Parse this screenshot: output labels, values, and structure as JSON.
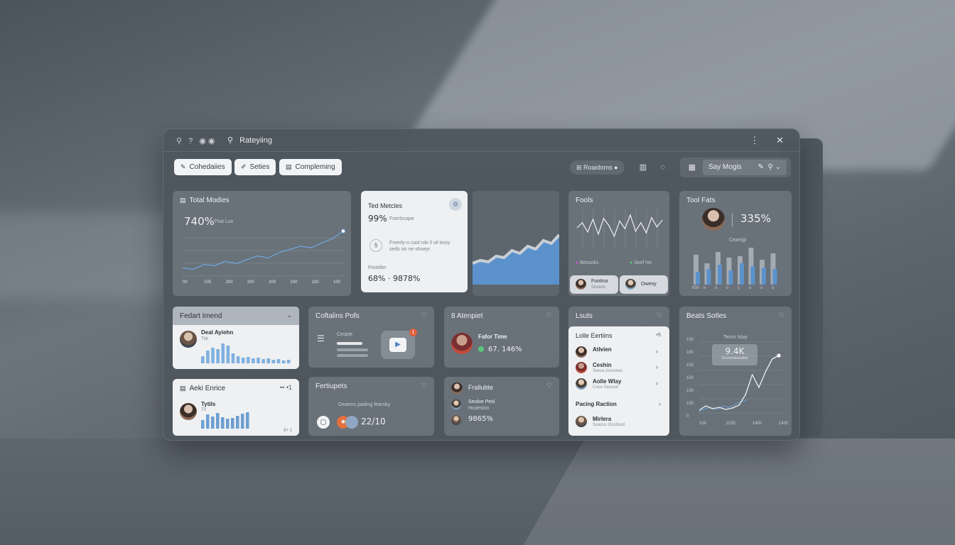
{
  "titlebar": {
    "icons": "⚲ ? ◉◉",
    "search_text": "Rateyiing",
    "menu_icon": "⋮",
    "close_icon": "✕"
  },
  "chips": [
    {
      "label": "Cohedaiies",
      "icon": "pencil-icon"
    },
    {
      "label": "Seties",
      "icon": "pin-icon"
    },
    {
      "label": "Compleming",
      "icon": "document-icon"
    }
  ],
  "toolbar": {
    "pill_label": "Roaidoms",
    "say_label": "Say Mogis"
  },
  "cards": {
    "total_metrics": {
      "title": "Total Modies",
      "value": "740%",
      "value_label": "That Lus",
      "x_labels": [
        "00",
        "205",
        "200",
        "200",
        "200",
        "200",
        "180",
        "100"
      ],
      "line": [
        18,
        15,
        24,
        22,
        30,
        26,
        33,
        40,
        36,
        46,
        52,
        58,
        55,
        64,
        72,
        86
      ]
    },
    "ted_metrics": {
      "title": "Ted Metcles",
      "value": "99%",
      "value_label": "Foerlscape",
      "desc1": "Freerly-o cool rde il oil tesiy",
      "desc2": "seds on ne shoeyr.",
      "footer_label": "Postdler",
      "footer_value": "68% · 9878%",
      "area": [
        30,
        34,
        32,
        40,
        38,
        48,
        44,
        54,
        50,
        62,
        58,
        70
      ]
    },
    "fools": {
      "title": "Fools",
      "legend1": "Bessoks",
      "legend2": "Sosf hin",
      "btn1": "Footina",
      "btn1_sub": "Soseds",
      "btn2": "Oweoy",
      "wave": [
        50,
        62,
        40,
        70,
        35,
        72,
        55,
        30,
        66,
        48,
        80,
        42,
        62,
        38,
        74,
        52,
        68
      ]
    },
    "tool_fats": {
      "title": "Tool Fats",
      "value": "335%",
      "sublabel": "Ceartigi",
      "bars_gray": [
        42,
        30,
        46,
        38,
        40,
        52,
        35,
        44
      ],
      "bars_blue": [
        18,
        22,
        28,
        20,
        30,
        26,
        24,
        22
      ],
      "x_labels": [
        "000",
        "e",
        "o",
        "o",
        "c",
        "o",
        "o",
        "o"
      ]
    },
    "feature_trend": {
      "title": "Fedart Imend",
      "name": "Deal Ayiehn",
      "sub": "Thit",
      "bars": [
        10,
        18,
        22,
        20,
        28,
        25,
        14,
        10,
        8,
        9,
        7,
        8,
        6,
        7,
        5,
        6,
        4,
        5
      ]
    },
    "add_enrice": {
      "title": "Aeki Enrice",
      "corner": "•• •1",
      "name": "Tytils",
      "sub": "Tri",
      "footer": "9+ 1",
      "bars": [
        12,
        20,
        17,
        22,
        16,
        14,
        15,
        18,
        21,
        23
      ]
    },
    "contains_posts": {
      "title": "Coftalins Pofs",
      "label": "Ceopie",
      "badge": "1"
    },
    "fertiupets": {
      "title": "Fertiupets",
      "desc": "Oearers pading fearsby",
      "value": "22/10"
    },
    "atempiet": {
      "title": "8 Atenpiet",
      "name": "Fafor Time",
      "value": "67. 146%"
    },
    "frallubte": {
      "title": "Frallubte",
      "row1": "Seoloe Pesl",
      "row1_sub": "Hodesloo",
      "value": "9865%"
    },
    "lists": {
      "title": "Lsuts",
      "inner_title": "Lolle Eertiins",
      "inner_corner": "•5",
      "rows": [
        {
          "name": "Atlvien",
          "sub": ""
        },
        {
          "name": "Ceshin",
          "sub": "Seeus lossnnes"
        },
        {
          "name": "Aolle Wlay",
          "sub": "Coso Sesoud"
        }
      ],
      "section": "Pacing Raction",
      "footer_name": "Mirlera",
      "footer_sub": "Soasss Occdsed"
    },
    "beats_series": {
      "title": "Beats Sotles",
      "tag": "Tenro Islay",
      "value": "9.4K",
      "value_sub": "Sonsendeiaalinn",
      "y_labels": [
        "150",
        "180",
        "150",
        "150",
        "150",
        "150",
        "0"
      ],
      "x_labels": [
        "100",
        "2235",
        "1400",
        "1400"
      ],
      "line": [
        8,
        14,
        10,
        12,
        9,
        11,
        15,
        30,
        58,
        40,
        62,
        80,
        85
      ],
      "line2": [
        6,
        10,
        12,
        9,
        14,
        12,
        16,
        20,
        22
      ]
    }
  },
  "colors": {
    "accent_blue": "#6d9fd1",
    "card_gray": "#6c747c",
    "card_white": "#eef0f2"
  }
}
